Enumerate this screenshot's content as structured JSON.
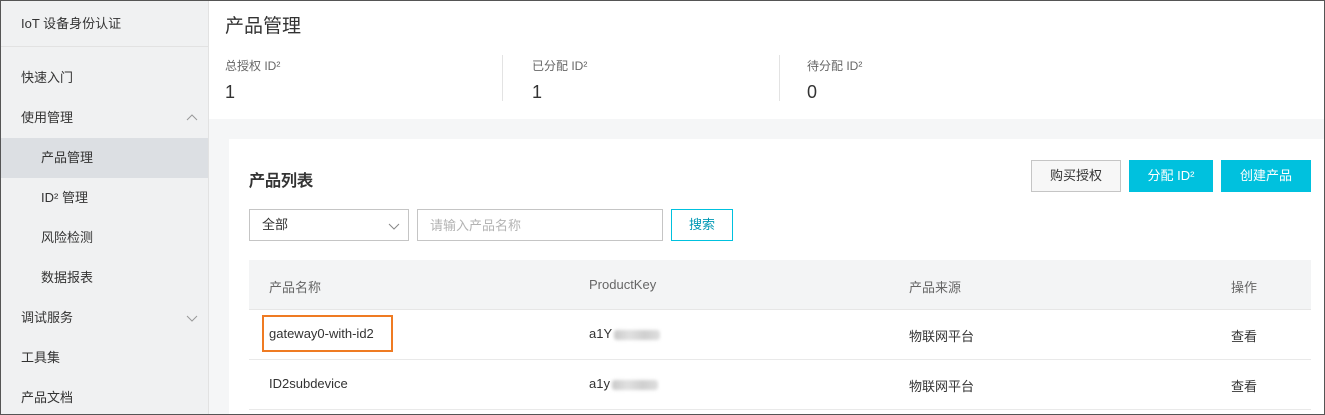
{
  "sidebar": {
    "title": "IoT 设备身份认证",
    "items": [
      {
        "label": "快速入门"
      },
      {
        "label": "使用管理"
      },
      {
        "label": "产品管理"
      },
      {
        "label": "ID² 管理"
      },
      {
        "label": "风险检测"
      },
      {
        "label": "数据报表"
      },
      {
        "label": "调试服务"
      },
      {
        "label": "工具集"
      },
      {
        "label": "产品文档"
      }
    ]
  },
  "header": {
    "title": "产品管理",
    "stats": [
      {
        "label": "总授权 ID²",
        "value": "1"
      },
      {
        "label": "已分配 ID²",
        "value": "1"
      },
      {
        "label": "待分配 ID²",
        "value": "0"
      }
    ]
  },
  "product_list": {
    "title": "产品列表",
    "buttons": {
      "buy": "购买授权",
      "assign": "分配 ID²",
      "create": "创建产品"
    },
    "filter": {
      "selected": "全部",
      "placeholder": "请输入产品名称",
      "search": "搜索"
    },
    "columns": [
      "产品名称",
      "ProductKey",
      "产品来源",
      "操作"
    ],
    "rows": [
      {
        "name": "gateway0-with-id2",
        "key_prefix": "a1Y",
        "source": "物联网平台",
        "action": "查看"
      },
      {
        "name": "ID2subdevice",
        "key_prefix": "a1y",
        "source": "物联网平台",
        "action": "查看"
      }
    ]
  },
  "colors": {
    "accent": "#00c1de",
    "link": "#0a8fbd",
    "highlight": "#ef7b23"
  }
}
